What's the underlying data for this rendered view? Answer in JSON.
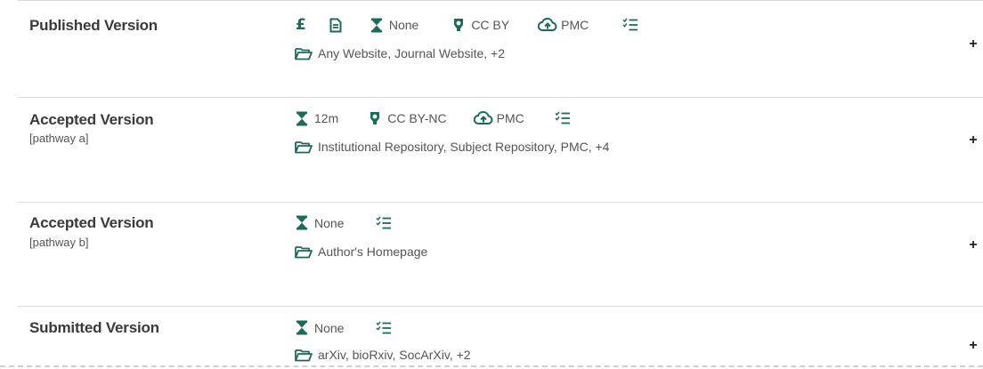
{
  "theme": {
    "accent": "#1d6a5a",
    "text": "#555555",
    "title": "#3a3a3a",
    "divider": "#dcdcdc"
  },
  "rows": [
    {
      "title": "Published Version",
      "subtitle": "",
      "fee_symbol": "£",
      "embargo": "None",
      "license": "CC BY",
      "deposit": "PMC",
      "locations": "Any Website, Journal Website, +2",
      "expand": "+"
    },
    {
      "title": "Accepted Version",
      "subtitle": "[pathway a]",
      "embargo": "12m",
      "license": "CC BY-NC",
      "deposit": "PMC",
      "locations": "Institutional Repository, Subject Repository, PMC, +4",
      "expand": "+"
    },
    {
      "title": "Accepted Version",
      "subtitle": "[pathway b]",
      "embargo": "None",
      "locations": "Author's Homepage",
      "expand": "+"
    },
    {
      "title": "Submitted Version",
      "subtitle": "",
      "embargo": "None",
      "locations": "arXiv, bioRxiv, SocArXiv, +2",
      "expand": "+"
    }
  ],
  "icons": {
    "fee": "pound-icon",
    "document": "document-icon",
    "embargo": "hourglass-icon",
    "license": "license-icon",
    "deposit": "cloud-upload-icon",
    "conditions": "checklist-icon",
    "locations": "folder-icon"
  }
}
